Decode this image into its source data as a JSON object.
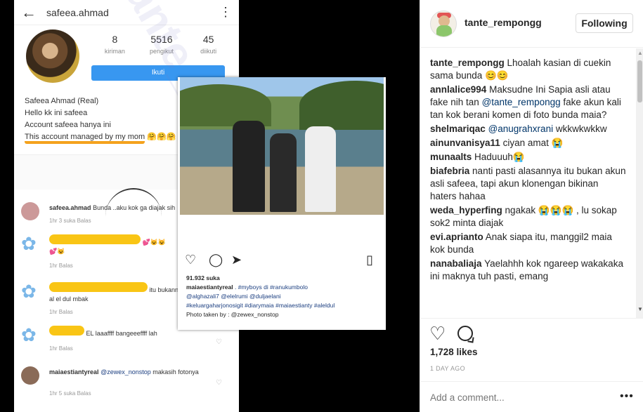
{
  "screenshot": {
    "top_user": "safeea.ahmad",
    "stats": [
      {
        "n": "8",
        "l": "kiriman"
      },
      {
        "n": "5516",
        "l": "pengikut"
      },
      {
        "n": "45",
        "l": "diikuti"
      }
    ],
    "follow_label": "Ikuti",
    "bio": [
      "Safeea Ahmad (Real)",
      "Hello kk ini safeea",
      "Account safeea hanya ini",
      "This account managed by my mom"
    ],
    "thread": [
      {
        "user": "safeea.ahmad",
        "text": "Bunda ..aku kok ga diajak sih",
        "meta": "1hr   3 suka   Balas"
      },
      {
        "text": "",
        "meta": "1hr   Balas"
      },
      {
        "text": "al el dul mbak",
        "tail": "itu bukanny",
        "meta": "1hr   Balas"
      },
      {
        "text": "EL laaaffff bangeeeffff lah",
        "meta": "1hr   Balas"
      },
      {
        "user": "maiaestiantyreal",
        "mention": "@zewex_nonstop",
        "text": "makasih fotonya",
        "meta": "1hr   5 suka   Balas"
      }
    ],
    "watermark": "tante_rempongg",
    "card_likes": "91.932 suka",
    "card_caption_user": "maiaestiantyreal",
    "card_caption": ". #myboys di #ranukumbolo",
    "card_tags": "@alghazali7 @elelrumi @duljaelani",
    "card_tags2": "#keluargaharjonosigit #diarymaia #maiaestianty #aleldul",
    "card_credit": "Photo taken by : @zewex_nonstop"
  },
  "post": {
    "username": "tante_rempongg",
    "follow_label": "Following",
    "likes": "1,728 likes",
    "time": "1 DAY AGO",
    "add_comment_placeholder": "Add a comment...",
    "more_icon": "more-horizontal-icon"
  },
  "comments": [
    {
      "user": "tante_rempongg",
      "text": "Lhoalah kasian di cuekin sama bunda 😊😊"
    },
    {
      "user": "annlalice994",
      "text": "Maksudne Ini Sapia asli atau fake nih tan",
      "mention": "@tante_rempongg",
      "text2": "fake akun kali tan kok berani komen di foto bunda maia?"
    },
    {
      "user": "shelmariqac",
      "mention": "@anugrahxrani",
      "text2": "wkkwkwkkw"
    },
    {
      "user": "ainunvanisya11",
      "text": "ciyan amat 😭"
    },
    {
      "user": "munaalts",
      "text": "Haduuuh😭"
    },
    {
      "user": "biafebria",
      "text": "nanti pasti alasannya itu bukan akun asli safeea, tapi akun klonengan bikinan haters hahaa"
    },
    {
      "user": "weda_hyperfing",
      "text": "ngakak 😭😭😭 , lu sokap sok2 minta diajak"
    },
    {
      "user": "evi.aprianto",
      "text": "Anak siapa itu, manggil2 maia kok bunda"
    },
    {
      "user": "nanabaliaja",
      "text": "Yaelahhh kok ngareep wakakaka ini maknya tuh pasti, emang"
    }
  ]
}
